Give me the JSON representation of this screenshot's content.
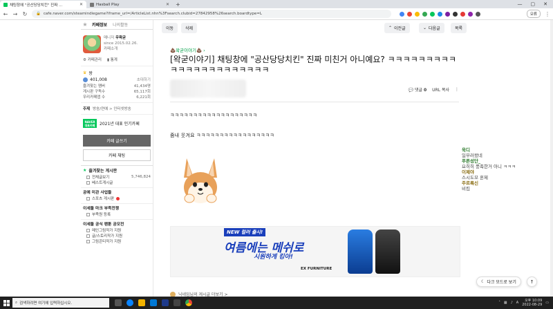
{
  "browser": {
    "tabs": [
      {
        "title": "채팅창에 \"공산당당치킨\" 진짜 ...",
        "active": true
      },
      {
        "title": "Hasball Play",
        "active": false
      }
    ],
    "url": "cafe.naver.com/steamindiegame?iframe_url=/ArticleList.nhn%3Fsearch.clubid=27842958%26search.boardtype=L",
    "profile_label": "오류"
  },
  "sidebar": {
    "tab_cafe_info": "카페정보",
    "tab_my_activity": "나의활동",
    "manager_label": "매니저",
    "manager_name": "우왁굳",
    "since": "since 2015.02.26.",
    "cafe_intro": "카페소개",
    "cafe_manage": "카페관리",
    "stats_link": "통계",
    "level_label": "왕",
    "member_count": "401,008",
    "invite_label": "초대하기",
    "stats": [
      {
        "label": "즐겨찾는 멤버",
        "value": "41,434명"
      },
      {
        "label": "게시판 구독수",
        "value": "65,117회"
      },
      {
        "label": "우리카페앱 수",
        "value": "6,221회"
      }
    ],
    "subject_label": "주제",
    "subject_value": "방송/연예 > 인터넷방송",
    "badge_text": "NAVER 대표카페",
    "badge_caption": "2021년 대표 인기카페",
    "write_button": "카페 글쓰기",
    "chat_button": "카페 채팅",
    "fav_boards_title": "즐겨찾는 게시판",
    "all_posts_label": "전체글보기",
    "all_posts_count": "5,746,824",
    "best_posts_label": "베스트게시글",
    "section1_title": "공예 미관 사업들",
    "section1_item": "스포츠 게시판",
    "section2_title": "이세돌 마크 부족전쟁",
    "section2_item": "부족원 등록",
    "section3_title": "이세돌 공식 팬툰 공모전",
    "section3_items": [
      "메인그림작가 지원",
      "글/스토리작가 지원",
      "그림콘티작가 지원"
    ]
  },
  "article": {
    "btn_move": "이동",
    "btn_delete": "삭제",
    "btn_prev": "이전글",
    "btn_next": "다음글",
    "btn_list": "목록",
    "category": "왁굳이야기",
    "title": "[왁굳이야기] 채팅창에 \"공산당당치킨\" 진짜 미친거 아니예요? ㅋㅋㅋㅋㅋㅋㅋㅋㅋㅋㅋㅋㅋㅋㅋㅋㅋㅋㅋㅋㅋㅋ",
    "comment_label": "댓글",
    "comment_count": "0",
    "url_copy": "URL 복사",
    "body_line1": "ㅋㅋㅋㅋㅋㅋㅋㅋㅋㅋㅋㅋㅋㅋㅋㅋㅋㅋㅋ",
    "body_line2": "줌내 웃겨요 ㅋㅋㅋㅋㅋㅋㅋㅋㅋㅋㅋㅋㅋㅋㅋㅋㅋ",
    "banner_new": "NEW 컬러 출시!",
    "banner_headline": "여름에는 메쉬로",
    "banner_sub": "시원하게 킹아!",
    "banner_brand": "EX FURNITURE",
    "next_author_text": "닉네임님의 게시글 더보기 >"
  },
  "chat_overlay": [
    {
      "text": "욱디",
      "color": "#2d7a2d",
      "bold": true
    },
    {
      "text": "일부러왔네",
      "color": "#444",
      "bold": false
    },
    {
      "text": "푸른성단_",
      "color": "#2d7a2d",
      "bold": true
    },
    {
      "text": "요히히 풍족한거 아니 ㅋㅋㅋ",
      "color": "#444",
      "bold": false
    },
    {
      "text": "이제야",
      "color": "#8a6d12",
      "bold": true
    },
    {
      "text": "스시도모 혼제",
      "color": "#444",
      "bold": false
    },
    {
      "text": "주르륵신",
      "color": "#8a6d12",
      "bold": true
    },
    {
      "text": "비킴",
      "color": "#444",
      "bold": false
    }
  ],
  "floating": {
    "dark_mode": "다크 모드로 보기"
  },
  "taskbar": {
    "search_placeholder": "검색하려면 여기에 입력하십시오.",
    "time": "오후 10:09",
    "date": "2022-08-29"
  }
}
